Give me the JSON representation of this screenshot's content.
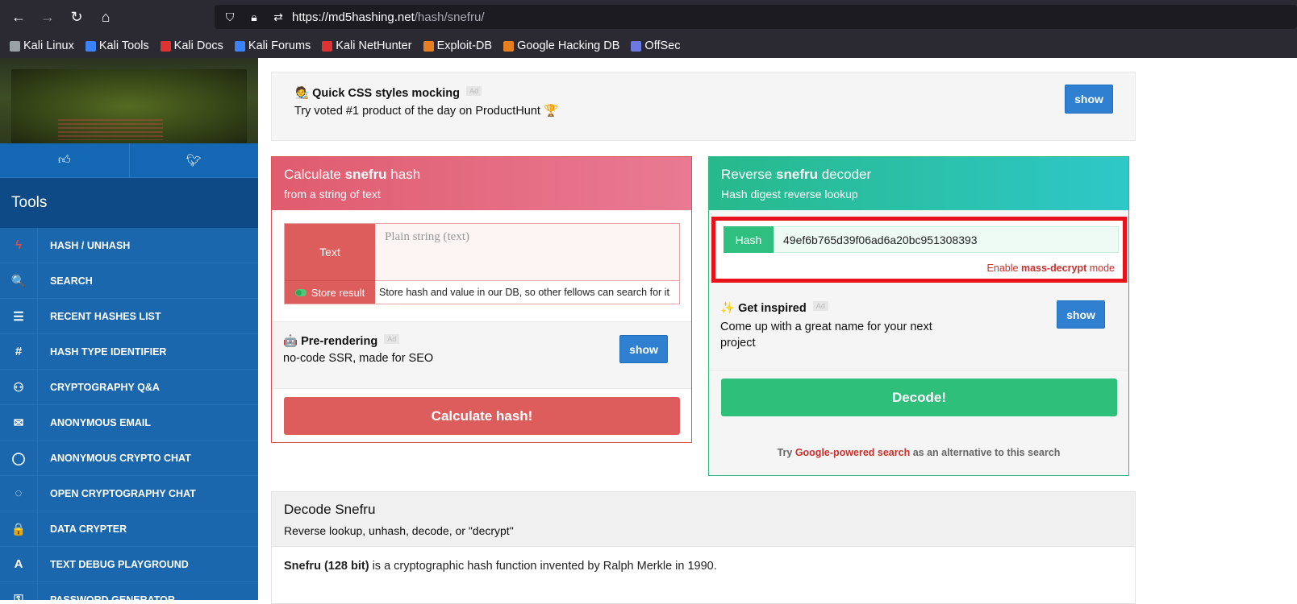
{
  "browser": {
    "url_host": "https://md5hashing.net",
    "url_path": "/hash/snefru/",
    "bookmarks": [
      {
        "label": "Kali Linux",
        "color": "#9aa0a6"
      },
      {
        "label": "Kali Tools",
        "color": "#3b82f6"
      },
      {
        "label": "Kali Docs",
        "color": "#d33"
      },
      {
        "label": "Kali Forums",
        "color": "#3b82f6"
      },
      {
        "label": "Kali NetHunter",
        "color": "#d33"
      },
      {
        "label": "Exploit-DB",
        "color": "#e67e22"
      },
      {
        "label": "Google Hacking DB",
        "color": "#e67e22"
      },
      {
        "label": "OffSec",
        "color": "#6c7ae0"
      }
    ]
  },
  "sidebar": {
    "tools_label": "Tools",
    "items": [
      {
        "label": "HASH / UNHASH",
        "icon": "bolt-icon",
        "glyph": "ϟ"
      },
      {
        "label": "SEARCH",
        "icon": "search-icon",
        "glyph": "🔍"
      },
      {
        "label": "RECENT HASHES LIST",
        "icon": "list-icon",
        "glyph": "☰"
      },
      {
        "label": "HASH TYPE IDENTIFIER",
        "icon": "hash-icon",
        "glyph": "#"
      },
      {
        "label": "CRYPTOGRAPHY Q&A",
        "icon": "qa-icon",
        "glyph": "⚇"
      },
      {
        "label": "ANONYMOUS EMAIL",
        "icon": "envelope-icon",
        "glyph": "✉"
      },
      {
        "label": "ANONYMOUS CRYPTO CHAT",
        "icon": "chat-bubble-icon",
        "glyph": "◯"
      },
      {
        "label": "OPEN CRYPTOGRAPHY CHAT",
        "icon": "chat-bubbles-icon",
        "glyph": "◌"
      },
      {
        "label": "DATA CRYPTER",
        "icon": "lock-icon",
        "glyph": "🔒"
      },
      {
        "label": "TEXT DEBUG PLAYGROUND",
        "icon": "font-icon",
        "glyph": "A"
      },
      {
        "label": "PASSWORD GENERATOR",
        "icon": "key-icon",
        "glyph": "⚿"
      }
    ]
  },
  "ad_top": {
    "emoji": "🧑‍🎨",
    "title": "Quick CSS styles mocking",
    "badge": "Ad",
    "text": "Try voted #1 product of the day on ProductHunt 🏆",
    "button": "show"
  },
  "calc_card": {
    "title_pre": "Calculate ",
    "title_bold": "snefru",
    "title_post": " hash",
    "subtitle": "from a string of text",
    "text_label": "Text",
    "placeholder": "Plain string (text)",
    "store_label": "Store result",
    "store_text": "Store hash and value in our DB, so other fellows can search for it",
    "ad_emoji": "🤖",
    "ad_title": "Pre-rendering",
    "ad_badge": "Ad",
    "ad_text": "no-code SSR, made for SEO",
    "ad_button": "show",
    "submit": "Calculate hash!"
  },
  "decoder_card": {
    "title_pre": "Reverse ",
    "title_bold": "snefru",
    "title_post": " decoder",
    "subtitle": "Hash digest reverse lookup",
    "hash_label": "Hash",
    "hash_value": "49ef6b765d39f06ad6a20bc951308393",
    "mass_pre": "Enable ",
    "mass_bold": "mass-decrypt",
    "mass_post": " mode",
    "ad_emoji": "✨",
    "ad_title": "Get inspired",
    "ad_badge": "Ad",
    "ad_text": "Come up with a great name for your next project",
    "ad_button": "show",
    "submit": "Decode!",
    "alt_pre": "Try ",
    "alt_link": "Google-powered search",
    "alt_post": " as an alternative to this search"
  },
  "decode_section": {
    "title": "Decode Snefru",
    "subtitle": "Reverse lookup, unhash, decode, or \"decrypt\"",
    "body_bold": "Snefru (128 bit)",
    "body_text": " is a cryptographic hash function invented by Ralph Merkle in 1990."
  }
}
